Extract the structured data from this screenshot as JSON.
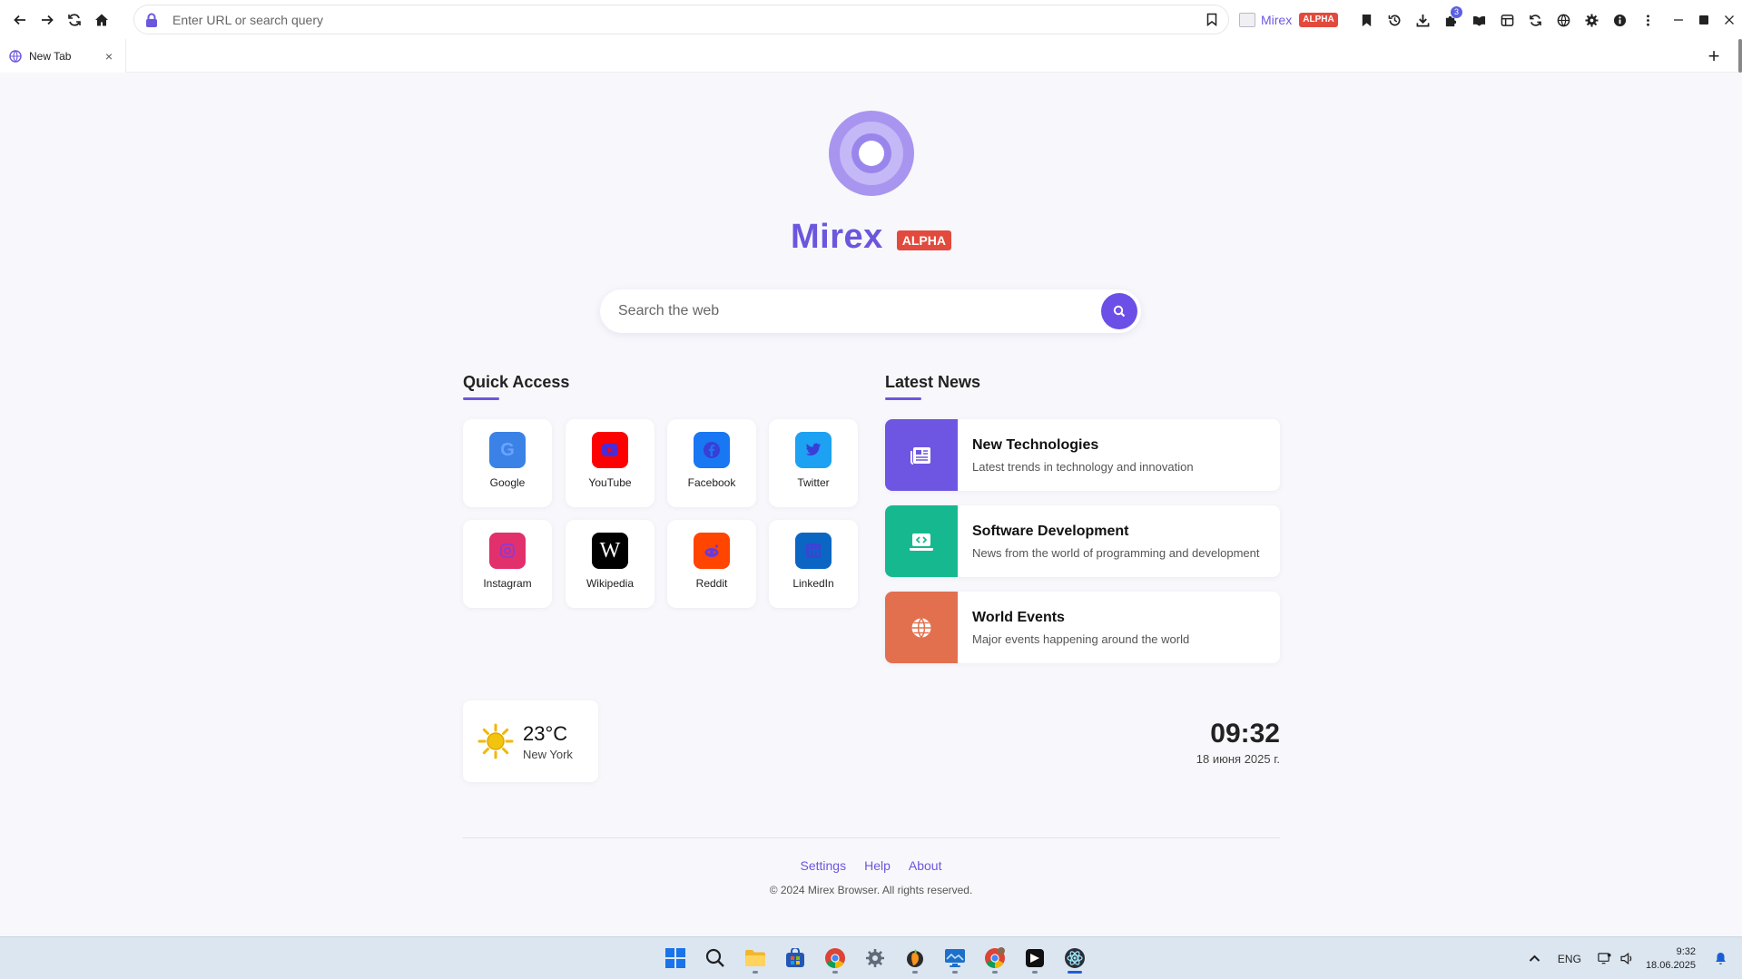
{
  "browser": {
    "url_placeholder": "Enter URL or search query",
    "brand_name": "Mirex",
    "brand_badge": "ALPHA",
    "extensions_badge": "3",
    "tab_title": "New Tab",
    "new_tab_label": "+",
    "tab_close_label": "×"
  },
  "hero": {
    "title": "Mirex",
    "badge": "ALPHA",
    "search_placeholder": "Search the web"
  },
  "quick_access": {
    "title": "Quick Access",
    "items": [
      {
        "label": "Google",
        "color": "#3b82e6",
        "glyph": "G"
      },
      {
        "label": "YouTube",
        "color": "#ff0000",
        "glyph": "▶"
      },
      {
        "label": "Facebook",
        "color": "#1877f2",
        "glyph": "f"
      },
      {
        "label": "Twitter",
        "color": "#1da1f2",
        "glyph": "t"
      },
      {
        "label": "Instagram",
        "color": "#e1306c",
        "glyph": "◎"
      },
      {
        "label": "Wikipedia",
        "color": "#000000",
        "glyph": "W"
      },
      {
        "label": "Reddit",
        "color": "#ff4500",
        "glyph": "●"
      },
      {
        "label": "LinkedIn",
        "color": "#0a66c2",
        "glyph": "in"
      }
    ]
  },
  "news": {
    "title": "Latest News",
    "items": [
      {
        "title": "New Technologies",
        "desc": "Latest trends in technology and innovation",
        "color": "#6e56e2",
        "icon": "newspaper-icon"
      },
      {
        "title": "Software Development",
        "desc": "News from the world of programming and development",
        "color": "#16b98f",
        "icon": "laptop-code-icon"
      },
      {
        "title": "World Events",
        "desc": "Major events happening around the world",
        "color": "#e2704f",
        "icon": "globe-icon"
      }
    ]
  },
  "weather": {
    "temp": "23°C",
    "city": "New York"
  },
  "clock": {
    "time": "09:32",
    "date": "18 июня 2025 г."
  },
  "footer": {
    "links": [
      "Settings",
      "Help",
      "About"
    ],
    "copyright": "© 2024 Mirex Browser. All rights reserved."
  },
  "taskbar": {
    "lang": "ENG",
    "time": "9:32",
    "date": "18.06.2025"
  },
  "colors": {
    "accent": "#6b57dd",
    "badge": "#e24a3d"
  }
}
